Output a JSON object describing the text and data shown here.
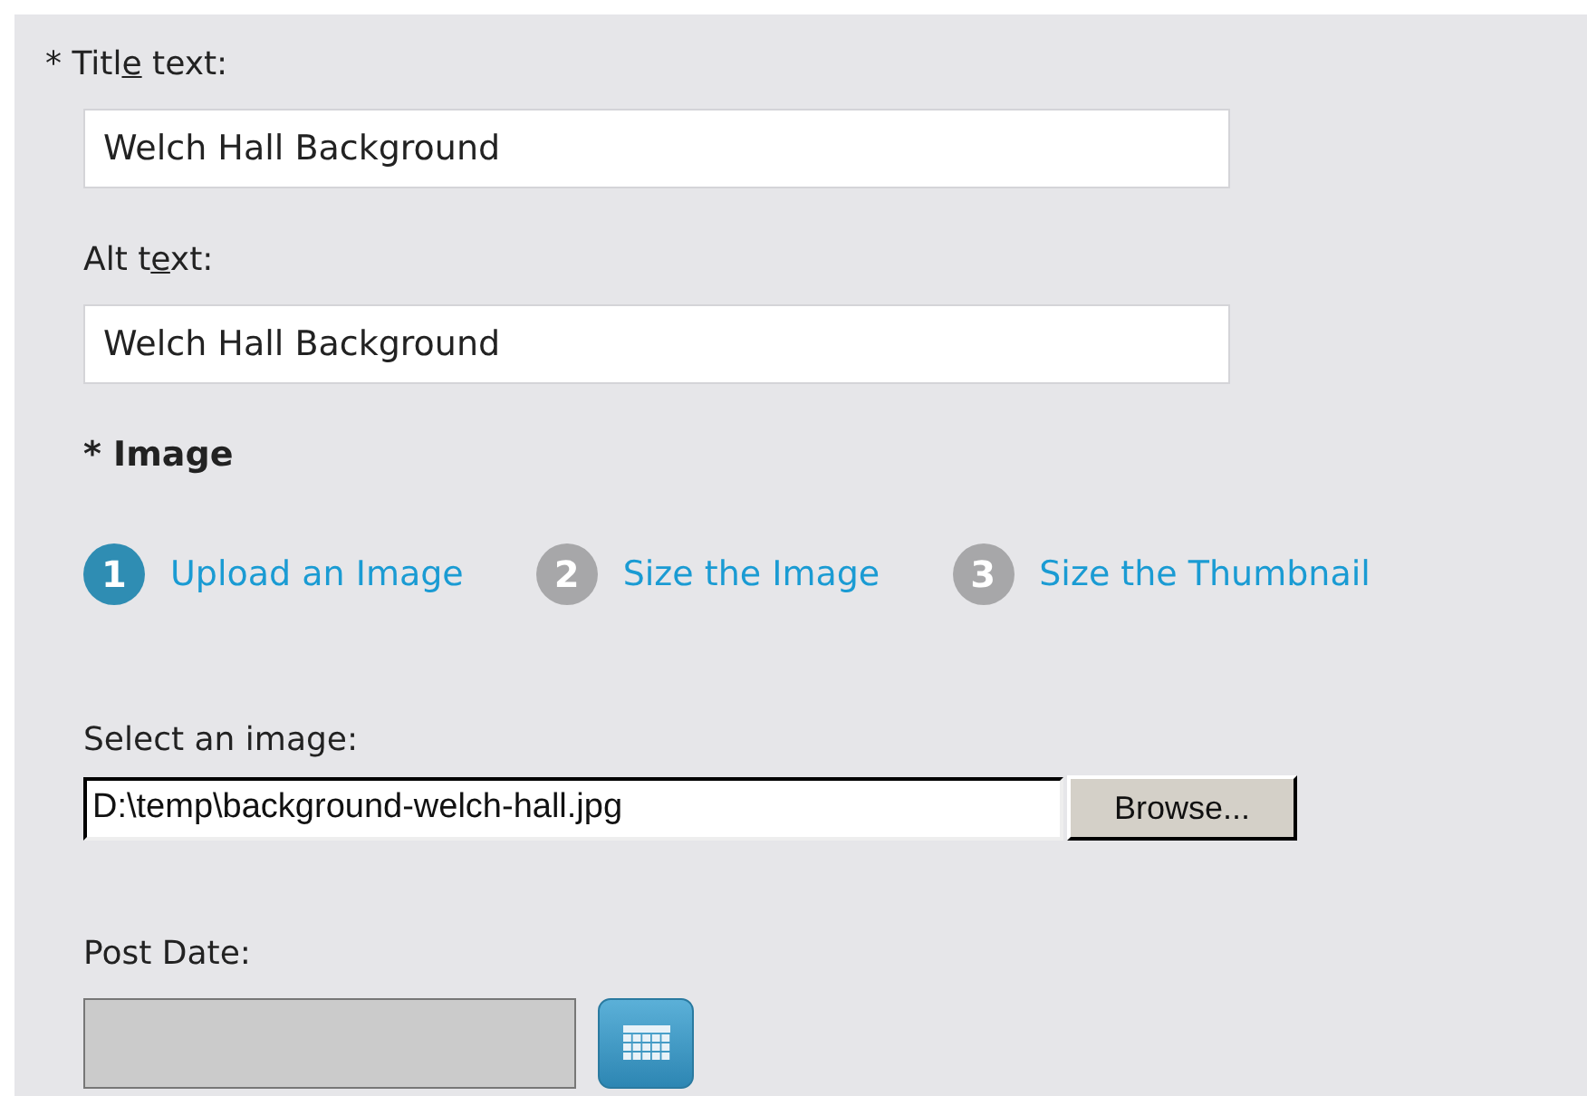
{
  "title_field": {
    "label_parts": [
      "* Titl",
      "e",
      " text:"
    ],
    "value": "Welch Hall Background"
  },
  "alt_field": {
    "label_parts": [
      "Alt t",
      "e",
      "xt:"
    ],
    "value": "Welch Hall Background"
  },
  "image_section": {
    "heading": "* Image",
    "steps": [
      {
        "number": "1",
        "label": "Upload an Image",
        "selected": true
      },
      {
        "number": "2",
        "label": "Size the Image",
        "selected": false
      },
      {
        "number": "3",
        "label": "Size the Thumbnail",
        "selected": false
      }
    ]
  },
  "file_field": {
    "label": "Select an image:",
    "value": "D:\\temp\\background-welch-hall.jpg",
    "button": "Browse..."
  },
  "post_date": {
    "label": "Post Date:",
    "disabled": true
  }
}
